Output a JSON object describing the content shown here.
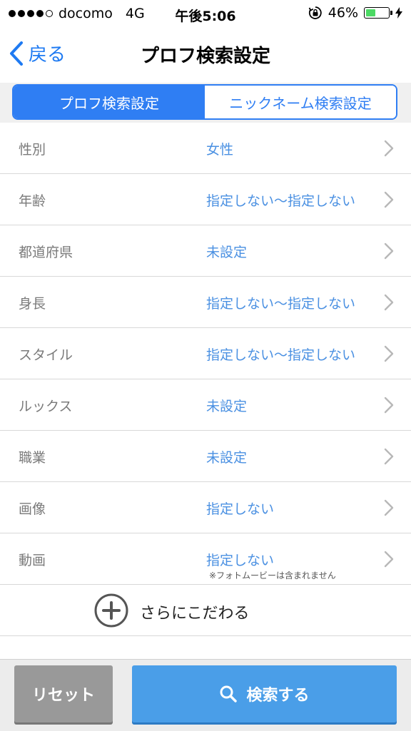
{
  "status_bar": {
    "carrier": "docomo",
    "network": "4G",
    "time": "午後5:06",
    "battery_percent": "46%",
    "battery_level": 0.46
  },
  "nav": {
    "back_label": "戻る",
    "title": "プロフ検索設定"
  },
  "tabs": [
    {
      "label": "プロフ検索設定",
      "active": true
    },
    {
      "label": "ニックネーム検索設定",
      "active": false
    }
  ],
  "rows": [
    {
      "label": "性別",
      "value": "女性"
    },
    {
      "label": "年齢",
      "value": "指定しない〜指定しない"
    },
    {
      "label": "都道府県",
      "value": "未設定"
    },
    {
      "label": "身長",
      "value": "指定しない〜指定しない"
    },
    {
      "label": "スタイル",
      "value": "指定しない〜指定しない"
    },
    {
      "label": "ルックス",
      "value": "未設定"
    },
    {
      "label": "職業",
      "value": "未設定"
    },
    {
      "label": "画像",
      "value": "指定しない"
    },
    {
      "label": "動画",
      "value": "指定しない",
      "note": "※フォトムービーは含まれません"
    }
  ],
  "more": {
    "label": "さらにこだわる"
  },
  "bottom": {
    "reset_label": "リセット",
    "search_label": "検索する"
  },
  "colors": {
    "accent": "#2f7ef3",
    "value_text": "#4a90e2",
    "search_button": "#4a9ee8",
    "reset_button": "#999999",
    "battery": "#4cd964"
  },
  "icons": {
    "back": "chevron-left-icon",
    "row": "chevron-right-icon",
    "more": "plus-circle-icon",
    "search": "magnifier-icon",
    "lock": "rotation-lock-icon",
    "charging": "bolt-icon"
  }
}
